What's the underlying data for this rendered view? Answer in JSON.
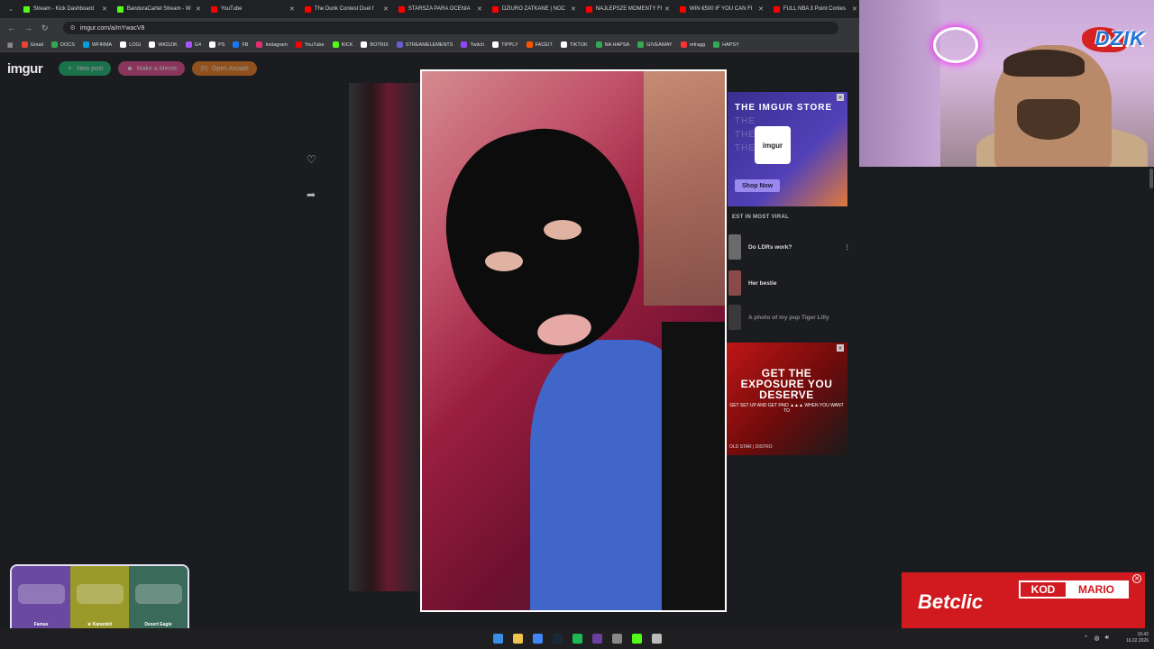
{
  "browser": {
    "tabs": [
      {
        "label": "Stream - Kick Dashboard",
        "color": "#53fc18"
      },
      {
        "label": "BanduraCartel Stream - W",
        "color": "#53fc18"
      },
      {
        "label": "YouTube",
        "color": "#ff0000"
      },
      {
        "label": "The Dunk Contest Duel f",
        "color": "#ff0000"
      },
      {
        "label": "STARSZA PARA OCENIA",
        "color": "#ff0000"
      },
      {
        "label": "DZIURO ZATKANE | NOC",
        "color": "#ff0000"
      },
      {
        "label": "NAJLEPSZE MOMENTY FI",
        "color": "#ff0000"
      },
      {
        "label": "WIN €500 IF YOU CAN FI",
        "color": "#ff0000"
      },
      {
        "label": "FULL NBA 3 Point Contes",
        "color": "#ff0000"
      }
    ],
    "url": "imgur.com/a/mYwacV8",
    "bookmarks": [
      {
        "label": "Gmail",
        "color": "#ea4335"
      },
      {
        "label": "DOCS",
        "color": "#34a853"
      },
      {
        "label": "WFIRMA",
        "color": "#00a0e0"
      },
      {
        "label": "LOGI",
        "color": "#ffffff"
      },
      {
        "label": "WKDZIK",
        "color": "#ffffff"
      },
      {
        "label": "G4",
        "color": "#a855f7"
      },
      {
        "label": "PS",
        "color": "#ffffff"
      },
      {
        "label": "FB",
        "color": "#1877f2"
      },
      {
        "label": "Instagram",
        "color": "#e1306c"
      },
      {
        "label": "YouTube",
        "color": "#ff0000"
      },
      {
        "label": "KICK",
        "color": "#53fc18"
      },
      {
        "label": "BOTRIX",
        "color": "#ffffff"
      },
      {
        "label": "STREAMELEMENTS",
        "color": "#6a5acd"
      },
      {
        "label": "Twitch",
        "color": "#9146ff"
      },
      {
        "label": "TIPPLY",
        "color": "#ffffff"
      },
      {
        "label": "FACEIT",
        "color": "#ff5500"
      },
      {
        "label": "TIKTOK",
        "color": "#ffffff"
      },
      {
        "label": "NA HAPSA",
        "color": "#34a853"
      },
      {
        "label": "GIVEAWAY",
        "color": "#34a853"
      },
      {
        "label": "refragg",
        "color": "#ff3333"
      },
      {
        "label": "HAPSY",
        "color": "#34a853"
      }
    ]
  },
  "imgur": {
    "logo": "imgur",
    "new_post": "New post",
    "make_meme": "Make a Meme",
    "open_arcade": "Open Arcade",
    "store_ad": {
      "title": "THE IMGUR STORE",
      "ghost_line": "THE",
      "mug_text": "imgur",
      "button": "Shop Now"
    },
    "viral_section": "EST IN MOST VIRAL",
    "viral_items": [
      "Do LDRs work?",
      "Her bestie",
      "A photo of my pup Tiger Lilly"
    ],
    "exposure_ad": {
      "headline": "GET THE EXPOSURE YOU DESERVE",
      "sub": "GET SET UP AND GET PAID ▲▲▲ WHEN YOU WANT TO",
      "bottom": "OLD STAR | DISTRO"
    }
  },
  "overlay": {
    "dzik_logo": "DZIK",
    "betclic": {
      "brand": "Betclic",
      "kod": "KOD",
      "code": "MARIO"
    },
    "skins": [
      {
        "name": "Famas",
        "rank": "Sergeant",
        "color": "#6a4aa0"
      },
      {
        "name": "★ Karambit",
        "rank": "Case Hardened",
        "color": "#9a9a2a"
      },
      {
        "name": "Desert Eagle",
        "rank": "Printstream",
        "color": "#3a6a5a"
      }
    ]
  },
  "taskbar": {
    "icons": [
      {
        "name": "windows-start",
        "color": "#3b8ee8"
      },
      {
        "name": "file-explorer",
        "color": "#f2c14e"
      },
      {
        "name": "chrome",
        "color": "#4285f4"
      },
      {
        "name": "steam",
        "color": "#1b2838"
      },
      {
        "name": "spotify",
        "color": "#1db954"
      },
      {
        "name": "obs",
        "color": "#6b3fa0"
      },
      {
        "name": "settings",
        "color": "#888888"
      },
      {
        "name": "kick",
        "color": "#53fc18"
      },
      {
        "name": "arrow",
        "color": "#bbbbbb"
      }
    ],
    "time": "16:42",
    "date": "16.02.2026"
  }
}
